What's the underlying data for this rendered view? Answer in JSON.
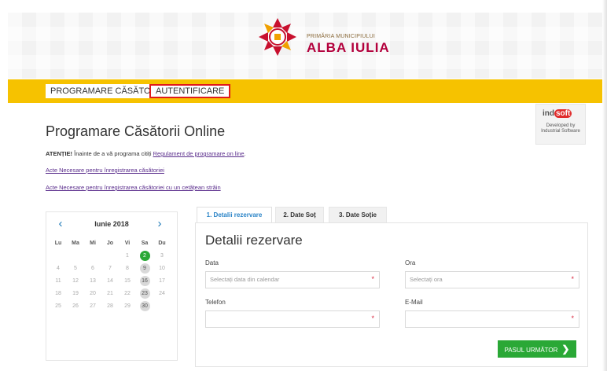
{
  "header": {
    "logo_small": "PRIMĂRIA MUNICIPIULUI",
    "logo_big": "ALBA IULIA"
  },
  "nav": {
    "programare": "PROGRAMARE CĂSĂTORII",
    "autentificare": "AUTENTIFICARE"
  },
  "badge": {
    "brand_prefix": "ind",
    "brand_suffix": "soft",
    "caption": "Developed by Industrial Software"
  },
  "page": {
    "title": "Programare Căsătorii Online",
    "notice_label": "ATENȚIE!",
    "notice_text": " Înainte de a vă programa citiți ",
    "notice_link": "Regulament de programare on line",
    "notice_end": ".",
    "link1": "Acte Necesare pentru înregistrarea căsătoriei",
    "link2": "Acte Necesare pentru înregistrarea căsătoriei cu un cetățean străin"
  },
  "calendar": {
    "prev": "‹",
    "next": "›",
    "month": "Iunie 2018",
    "days_of_week": [
      "Lu",
      "Ma",
      "Mi",
      "Jo",
      "Vi",
      "Sa",
      "Du"
    ],
    "weeks": [
      [
        "",
        "",
        "",
        "",
        "1",
        "2",
        "3"
      ],
      [
        "4",
        "5",
        "6",
        "7",
        "8",
        "9",
        "10"
      ],
      [
        "11",
        "12",
        "13",
        "14",
        "15",
        "16",
        "17"
      ],
      [
        "18",
        "19",
        "20",
        "21",
        "22",
        "23",
        "24"
      ],
      [
        "25",
        "26",
        "27",
        "28",
        "29",
        "30",
        ""
      ]
    ],
    "highlight_green": [
      "2"
    ],
    "highlight_gray": [
      "9",
      "16",
      "23",
      "30"
    ]
  },
  "tabs": [
    "1. Detalii rezervare",
    "2. Date Soț",
    "3. Date Soție"
  ],
  "form": {
    "title": "Detalii rezervare",
    "data_label": "Data",
    "data_placeholder": "Selectați data din calendar",
    "ora_label": "Ora",
    "ora_placeholder": "Selectați ora",
    "telefon_label": "Telefon",
    "email_label": "E-Mail",
    "required_mark": "*",
    "next_button": "PASUL URMĂTOR",
    "next_chevron": "❯"
  },
  "colors": {
    "nav_bar": "#f6c200",
    "highlight_border": "#e01b1b",
    "accent_green": "#2aa836",
    "tab_active": "#2b84c7",
    "link": "#5a2d8c"
  }
}
